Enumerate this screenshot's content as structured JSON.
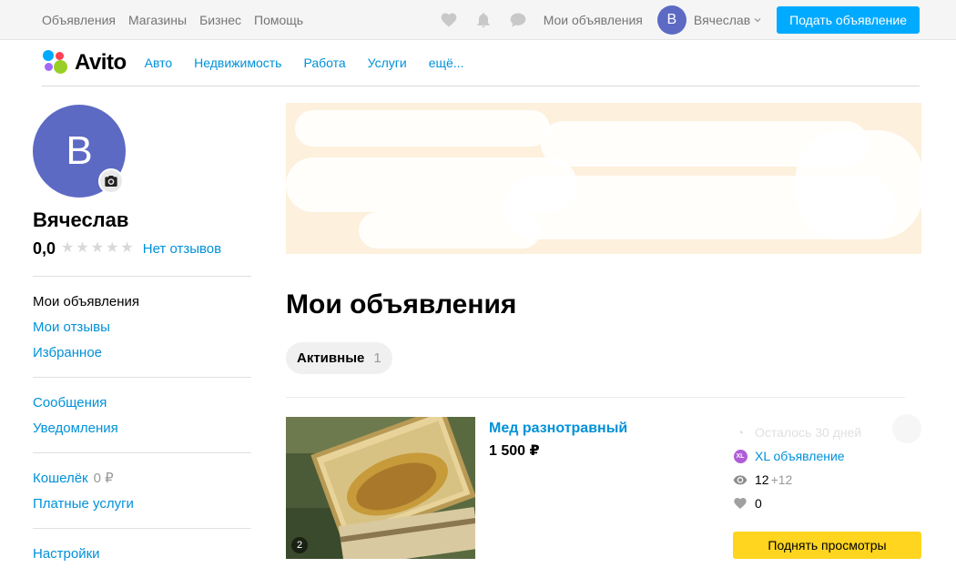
{
  "topbar": {
    "nav": [
      "Объявления",
      "Магазины",
      "Бизнес",
      "Помощь"
    ],
    "my_ads": "Мои объявления",
    "avatar_letter": "В",
    "user_name": "Вячеслав",
    "post_button": "Подать объявление",
    "icons": [
      "heart-icon",
      "bell-icon",
      "chat-icon"
    ]
  },
  "header": {
    "logo_text": "Avito",
    "logo_colors": [
      "#00aaff",
      "#ff4053",
      "#97cf26",
      "#a169f7"
    ],
    "categories": [
      "Авто",
      "Недвижимость",
      "Работа",
      "Услуги",
      "ещё..."
    ]
  },
  "profile": {
    "avatar_letter": "В",
    "name": "Вячеслав",
    "rating": "0,0",
    "stars_filled": 0,
    "stars_total": 5,
    "reviews_link": "Нет отзывов"
  },
  "sidebar": {
    "group1": [
      "Мои объявления",
      "Мои отзывы",
      "Избранное"
    ],
    "group2": [
      "Сообщения",
      "Уведомления"
    ],
    "wallet_label": "Кошелёк",
    "wallet_amount": "0 ₽",
    "paid_services": "Платные услуги",
    "settings": "Настройки"
  },
  "main": {
    "title": "Мои объявления",
    "tab_label": "Активные",
    "tab_count": "1"
  },
  "ad": {
    "title": "Мед разнотравный",
    "price": "1 500 ₽",
    "photo_count": "2",
    "remaining": "Осталось 30 дней",
    "xl_badge": "XL",
    "xl_label": "XL объявление",
    "views": "12",
    "views_today": "+12",
    "favorites": "0",
    "raise_button": "Поднять просмотры"
  },
  "colors": {
    "accent_blue": "#0091d9",
    "post_button": "#00aaff",
    "raise_button": "#ffd51f",
    "avatar": "#5c6ac4"
  }
}
